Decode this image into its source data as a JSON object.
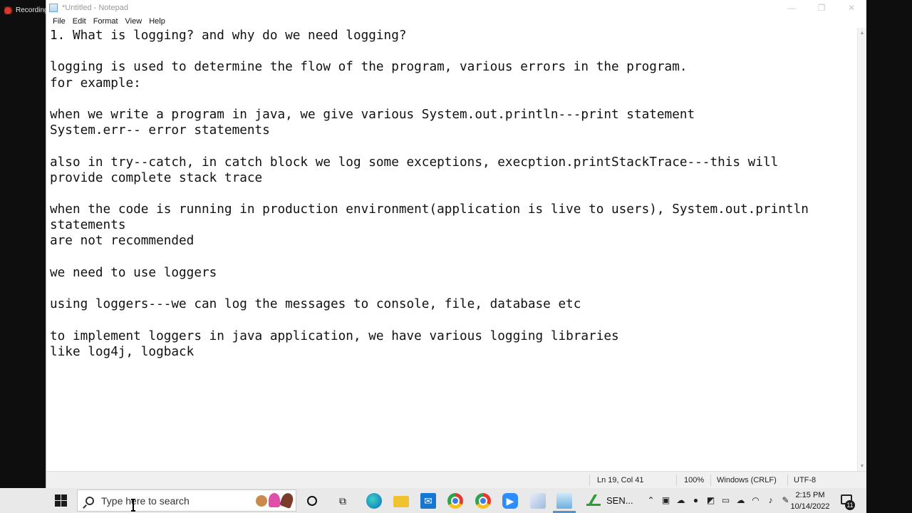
{
  "recording": {
    "label": "Recording",
    "icon": "recording-dot-icon"
  },
  "window": {
    "title": "*Untitled - Notepad",
    "controls": {
      "minimize": "—",
      "restore": "❐",
      "close": "✕"
    }
  },
  "menu": [
    "File",
    "Edit",
    "Format",
    "View",
    "Help"
  ],
  "editor": {
    "lines": [
      "1. What is logging? and why do we need logging?",
      "",
      "logging is used to determine the flow of the program, various errors in the program.",
      "for example:",
      "",
      "when we write a program in java, we give various System.out.println---print statement",
      "System.err-- error statements",
      "",
      "also in try--catch, in catch block we log some exceptions, execption.printStackTrace---this will",
      "provide complete stack trace",
      "",
      "when the code is running in production environment(application is live to users), System.out.println",
      "statements",
      "are not recommended",
      "",
      "we need to use loggers",
      "",
      "using loggers---we can log the messages to console, file, database etc",
      "",
      "to implement loggers in java application, we have various logging libraries",
      "like log4j, logback"
    ]
  },
  "status": {
    "position": "Ln 19, Col 41",
    "zoom": "100%",
    "line_ending": "Windows (CRLF)",
    "encoding": "UTF-8"
  },
  "taskbar": {
    "search_placeholder": "Type here to search",
    "sensex_label": "SEN...",
    "time": "2:15 PM",
    "date": "10/14/2022",
    "notification_count": "11"
  },
  "colors": {
    "taskbar": "#e9e9e9",
    "recording": "#d9372b",
    "active_indicator": "#5a8fc7"
  }
}
